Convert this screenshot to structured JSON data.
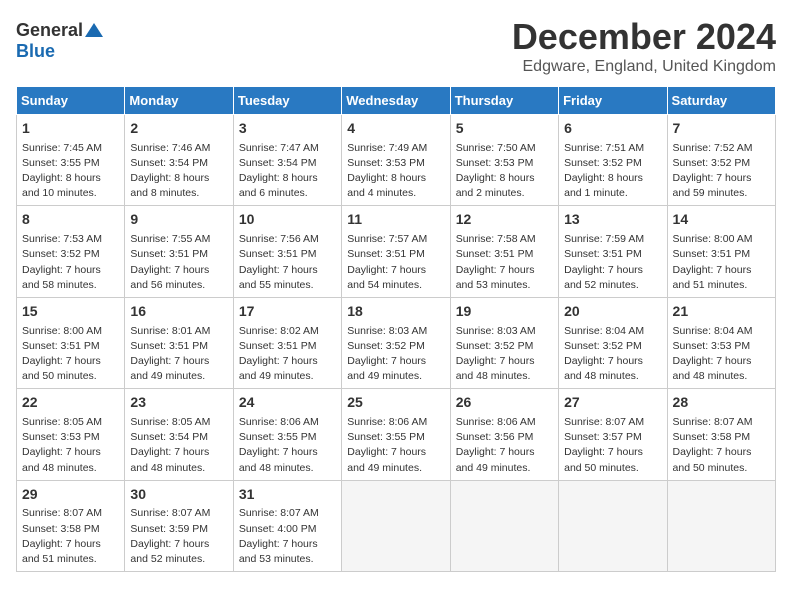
{
  "logo": {
    "general": "General",
    "blue": "Blue"
  },
  "title": "December 2024",
  "location": "Edgware, England, United Kingdom",
  "columns": [
    "Sunday",
    "Monday",
    "Tuesday",
    "Wednesday",
    "Thursday",
    "Friday",
    "Saturday"
  ],
  "weeks": [
    [
      {
        "day": "1",
        "lines": [
          "Sunrise: 7:45 AM",
          "Sunset: 3:55 PM",
          "Daylight: 8 hours",
          "and 10 minutes."
        ]
      },
      {
        "day": "2",
        "lines": [
          "Sunrise: 7:46 AM",
          "Sunset: 3:54 PM",
          "Daylight: 8 hours",
          "and 8 minutes."
        ]
      },
      {
        "day": "3",
        "lines": [
          "Sunrise: 7:47 AM",
          "Sunset: 3:54 PM",
          "Daylight: 8 hours",
          "and 6 minutes."
        ]
      },
      {
        "day": "4",
        "lines": [
          "Sunrise: 7:49 AM",
          "Sunset: 3:53 PM",
          "Daylight: 8 hours",
          "and 4 minutes."
        ]
      },
      {
        "day": "5",
        "lines": [
          "Sunrise: 7:50 AM",
          "Sunset: 3:53 PM",
          "Daylight: 8 hours",
          "and 2 minutes."
        ]
      },
      {
        "day": "6",
        "lines": [
          "Sunrise: 7:51 AM",
          "Sunset: 3:52 PM",
          "Daylight: 8 hours",
          "and 1 minute."
        ]
      },
      {
        "day": "7",
        "lines": [
          "Sunrise: 7:52 AM",
          "Sunset: 3:52 PM",
          "Daylight: 7 hours",
          "and 59 minutes."
        ]
      }
    ],
    [
      {
        "day": "8",
        "lines": [
          "Sunrise: 7:53 AM",
          "Sunset: 3:52 PM",
          "Daylight: 7 hours",
          "and 58 minutes."
        ]
      },
      {
        "day": "9",
        "lines": [
          "Sunrise: 7:55 AM",
          "Sunset: 3:51 PM",
          "Daylight: 7 hours",
          "and 56 minutes."
        ]
      },
      {
        "day": "10",
        "lines": [
          "Sunrise: 7:56 AM",
          "Sunset: 3:51 PM",
          "Daylight: 7 hours",
          "and 55 minutes."
        ]
      },
      {
        "day": "11",
        "lines": [
          "Sunrise: 7:57 AM",
          "Sunset: 3:51 PM",
          "Daylight: 7 hours",
          "and 54 minutes."
        ]
      },
      {
        "day": "12",
        "lines": [
          "Sunrise: 7:58 AM",
          "Sunset: 3:51 PM",
          "Daylight: 7 hours",
          "and 53 minutes."
        ]
      },
      {
        "day": "13",
        "lines": [
          "Sunrise: 7:59 AM",
          "Sunset: 3:51 PM",
          "Daylight: 7 hours",
          "and 52 minutes."
        ]
      },
      {
        "day": "14",
        "lines": [
          "Sunrise: 8:00 AM",
          "Sunset: 3:51 PM",
          "Daylight: 7 hours",
          "and 51 minutes."
        ]
      }
    ],
    [
      {
        "day": "15",
        "lines": [
          "Sunrise: 8:00 AM",
          "Sunset: 3:51 PM",
          "Daylight: 7 hours",
          "and 50 minutes."
        ]
      },
      {
        "day": "16",
        "lines": [
          "Sunrise: 8:01 AM",
          "Sunset: 3:51 PM",
          "Daylight: 7 hours",
          "and 49 minutes."
        ]
      },
      {
        "day": "17",
        "lines": [
          "Sunrise: 8:02 AM",
          "Sunset: 3:51 PM",
          "Daylight: 7 hours",
          "and 49 minutes."
        ]
      },
      {
        "day": "18",
        "lines": [
          "Sunrise: 8:03 AM",
          "Sunset: 3:52 PM",
          "Daylight: 7 hours",
          "and 49 minutes."
        ]
      },
      {
        "day": "19",
        "lines": [
          "Sunrise: 8:03 AM",
          "Sunset: 3:52 PM",
          "Daylight: 7 hours",
          "and 48 minutes."
        ]
      },
      {
        "day": "20",
        "lines": [
          "Sunrise: 8:04 AM",
          "Sunset: 3:52 PM",
          "Daylight: 7 hours",
          "and 48 minutes."
        ]
      },
      {
        "day": "21",
        "lines": [
          "Sunrise: 8:04 AM",
          "Sunset: 3:53 PM",
          "Daylight: 7 hours",
          "and 48 minutes."
        ]
      }
    ],
    [
      {
        "day": "22",
        "lines": [
          "Sunrise: 8:05 AM",
          "Sunset: 3:53 PM",
          "Daylight: 7 hours",
          "and 48 minutes."
        ]
      },
      {
        "day": "23",
        "lines": [
          "Sunrise: 8:05 AM",
          "Sunset: 3:54 PM",
          "Daylight: 7 hours",
          "and 48 minutes."
        ]
      },
      {
        "day": "24",
        "lines": [
          "Sunrise: 8:06 AM",
          "Sunset: 3:55 PM",
          "Daylight: 7 hours",
          "and 48 minutes."
        ]
      },
      {
        "day": "25",
        "lines": [
          "Sunrise: 8:06 AM",
          "Sunset: 3:55 PM",
          "Daylight: 7 hours",
          "and 49 minutes."
        ]
      },
      {
        "day": "26",
        "lines": [
          "Sunrise: 8:06 AM",
          "Sunset: 3:56 PM",
          "Daylight: 7 hours",
          "and 49 minutes."
        ]
      },
      {
        "day": "27",
        "lines": [
          "Sunrise: 8:07 AM",
          "Sunset: 3:57 PM",
          "Daylight: 7 hours",
          "and 50 minutes."
        ]
      },
      {
        "day": "28",
        "lines": [
          "Sunrise: 8:07 AM",
          "Sunset: 3:58 PM",
          "Daylight: 7 hours",
          "and 50 minutes."
        ]
      }
    ],
    [
      {
        "day": "29",
        "lines": [
          "Sunrise: 8:07 AM",
          "Sunset: 3:58 PM",
          "Daylight: 7 hours",
          "and 51 minutes."
        ]
      },
      {
        "day": "30",
        "lines": [
          "Sunrise: 8:07 AM",
          "Sunset: 3:59 PM",
          "Daylight: 7 hours",
          "and 52 minutes."
        ]
      },
      {
        "day": "31",
        "lines": [
          "Sunrise: 8:07 AM",
          "Sunset: 4:00 PM",
          "Daylight: 7 hours",
          "and 53 minutes."
        ]
      },
      null,
      null,
      null,
      null
    ]
  ]
}
